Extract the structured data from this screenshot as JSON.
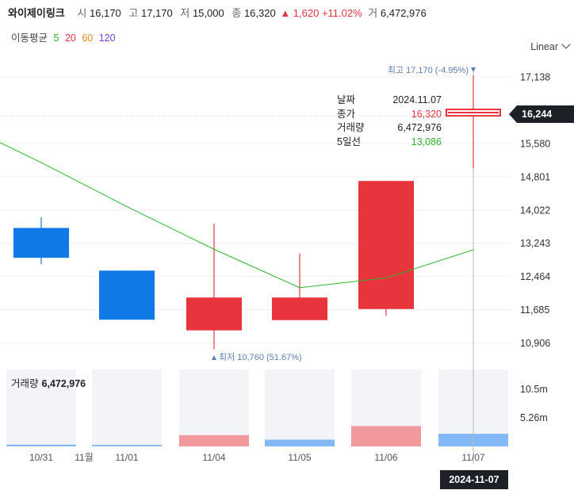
{
  "header": {
    "name": "와이제이링크",
    "open_label": "시",
    "open": "16,170",
    "high_label": "고",
    "high": "17,170",
    "low_label": "저",
    "low": "15,000",
    "close_label": "종",
    "close": "16,320",
    "change": "▲ 1,620 +11.02%",
    "volume_label": "거",
    "volume": "6,472,976"
  },
  "ma_legend": {
    "label": "이동평균",
    "items": [
      {
        "text": "5",
        "color": "#2db52d"
      },
      {
        "text": "20",
        "color": "#e8343c"
      },
      {
        "text": "60",
        "color": "#f08c1a"
      },
      {
        "text": "120",
        "color": "#7b3fe0"
      }
    ]
  },
  "scale_mode": "Linear",
  "tooltip": {
    "date_label": "날짜",
    "date": "2024.11.07",
    "close_label": "종가",
    "close": "16,320",
    "volume_label": "거래량",
    "volume": "6,472,976",
    "ma5_label": "5일선",
    "ma5": "13,086"
  },
  "current_price": "16,244",
  "crosshair_date": "2024-11-07",
  "volume_panel": {
    "label": "거래량",
    "value": "6,472,976"
  },
  "annotations": {
    "high": "최고 17,170 (-4.95%)",
    "low": "최저 10,760 (51.67%)"
  },
  "colors": {
    "up": "#e8343c",
    "down": "#0f7ae5",
    "ma5": "#2db52d",
    "crosshair": "#999999"
  },
  "chart_data": {
    "type": "candlestick",
    "categories": [
      "10/31",
      "11/01",
      "11/04",
      "11/05",
      "11/06",
      "11/07"
    ],
    "x_extra_label": "11월",
    "ohlc": [
      {
        "open": 13600,
        "high": 13850,
        "low": 12750,
        "close": 12900
      },
      {
        "open": 12600,
        "high": 12600,
        "low": 11450,
        "close": 11450
      },
      {
        "open": 11200,
        "high": 13700,
        "low": 10760,
        "close": 11970
      },
      {
        "open": 11440,
        "high": 13000,
        "low": 11440,
        "close": 11970
      },
      {
        "open": 11700,
        "high": 14700,
        "low": 11550,
        "close": 14700
      },
      {
        "open": 16170,
        "high": 17170,
        "low": 15000,
        "close": 16320
      }
    ],
    "ma5": {
      "name": "5",
      "values": [
        15130,
        14100,
        13100,
        12200,
        12430,
        13086
      ]
    },
    "ma5_prev": 15600,
    "volume": [
      310000,
      270000,
      2050000,
      1230000,
      3700000,
      2300000
    ],
    "volume_colors": [
      "down",
      "down",
      "up",
      "down",
      "up",
      "down"
    ],
    "y_ticks": [
      "17,138",
      "15,580",
      "14,801",
      "14,022",
      "13,243",
      "12,464",
      "11,685",
      "10,906"
    ],
    "y_tick_values": [
      17138,
      15580,
      14801,
      14022,
      13243,
      12464,
      11685,
      10906
    ],
    "y_range": [
      10450,
      17600
    ],
    "volume_ticks": [
      "10.5m",
      "5.26m"
    ],
    "volume_tick_values": [
      10500000,
      5260000
    ],
    "volume_max": 14000000
  }
}
